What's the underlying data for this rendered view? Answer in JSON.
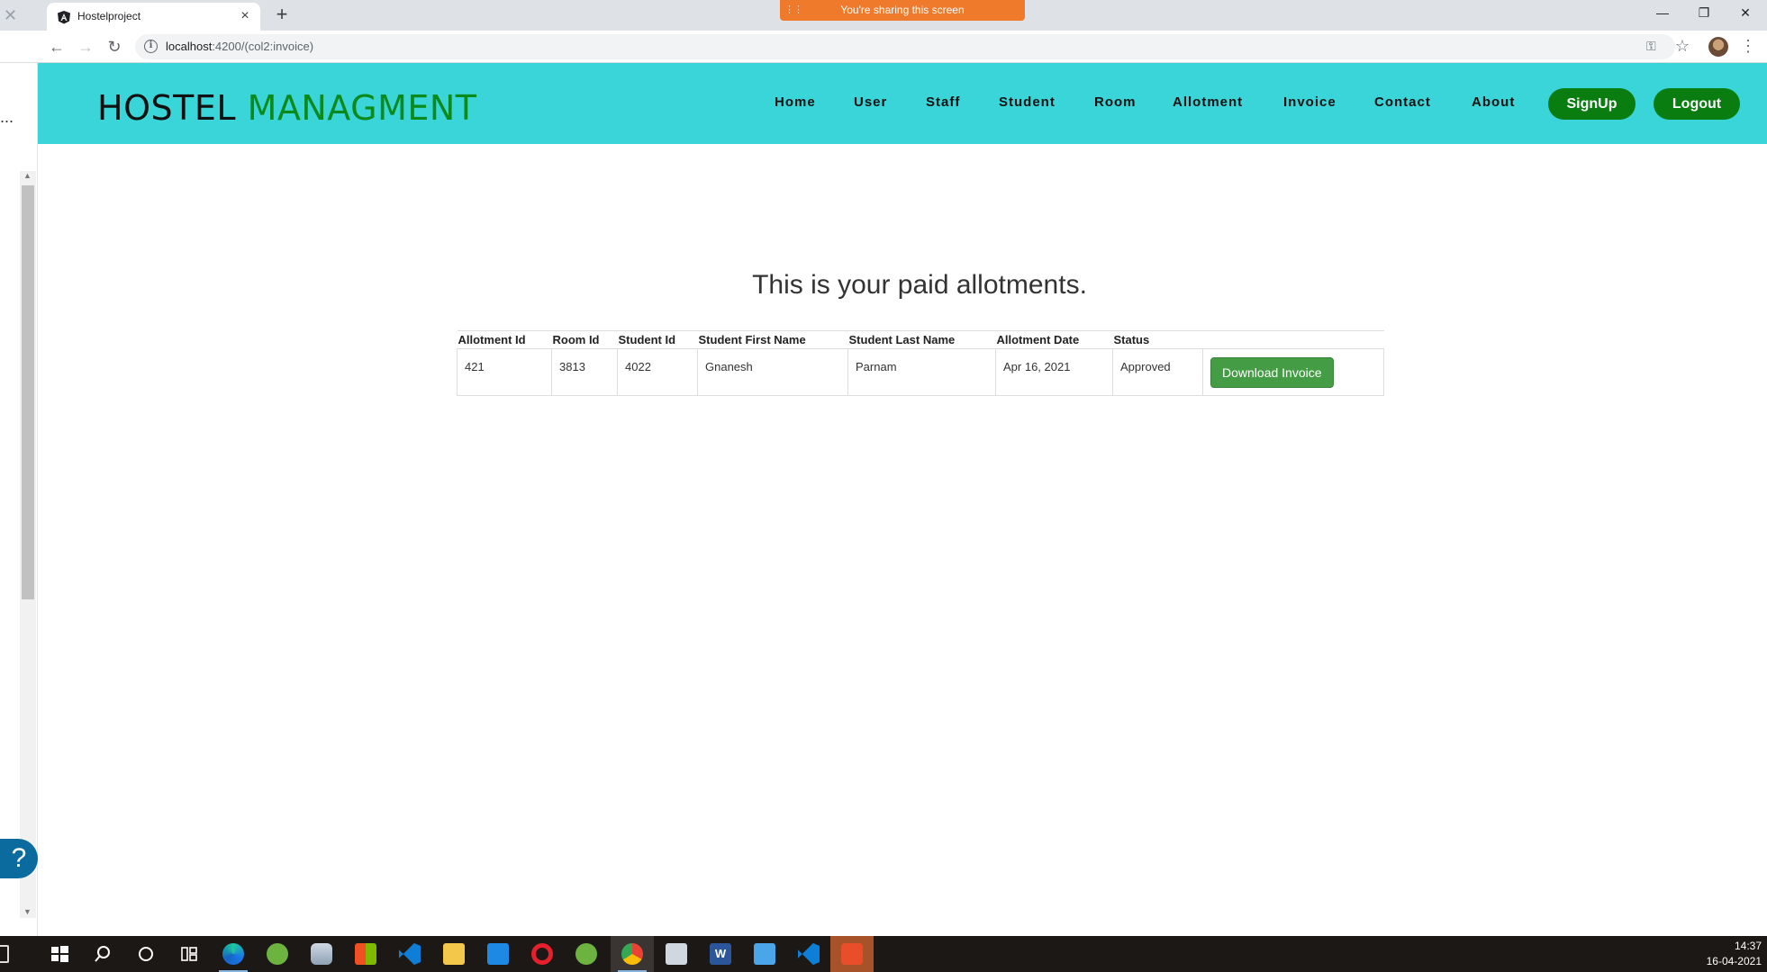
{
  "browser": {
    "tab_title": "Hostelproject",
    "tab_close": "×",
    "new_tab": "+",
    "sharing_banner": "You're sharing this screen",
    "url_host": "localhost",
    "url_rest": ":4200/(col2:invoice)",
    "window_controls": {
      "minimize": "—",
      "restore": "❐",
      "close": "✕"
    },
    "nav": {
      "back": "←",
      "forward": "→",
      "reload": "↻"
    }
  },
  "side_panel": {
    "dots": "...",
    "help": "?"
  },
  "site": {
    "brand_part1": "HOSTEL",
    "brand_part2": "MANAGMENT",
    "nav_links": [
      "Home",
      "User",
      "Staff",
      "Student",
      "Room",
      "Allotment",
      "Invoice",
      "Contact",
      "About"
    ],
    "signup_label": "SignUp",
    "logout_label": "Logout",
    "colors": {
      "header_bg": "#3ad5d8",
      "brand_green": "#0a8a1a",
      "pill_green": "#0a7d10",
      "download_btn": "#449d44"
    }
  },
  "main": {
    "heading": "This is your paid allotments.",
    "table": {
      "headers": [
        "Allotment Id",
        "Room Id",
        "Student Id",
        "Student First Name",
        "Student Last Name",
        "Allotment Date",
        "Status",
        ""
      ],
      "rows": [
        [
          "421",
          "3813",
          "4022",
          "Gnanesh",
          "Parnam",
          "Apr 16, 2021",
          "Approved"
        ]
      ],
      "download_label": "Download Invoice"
    }
  },
  "taskbar": {
    "time": "14:37",
    "date": "16-04-2021",
    "icons": [
      "start-icon",
      "search-icon",
      "cortana-icon",
      "task-view-icon",
      "edge-icon",
      "spring-tool-icon",
      "database-icon",
      "store-icon",
      "vscode-icon",
      "file-explorer-icon",
      "mail-icon",
      "opera-icon",
      "spring-tool-icon",
      "chrome-icon",
      "media-icon",
      "word-icon",
      "photos-icon",
      "vscode-icon",
      "git-icon"
    ]
  }
}
